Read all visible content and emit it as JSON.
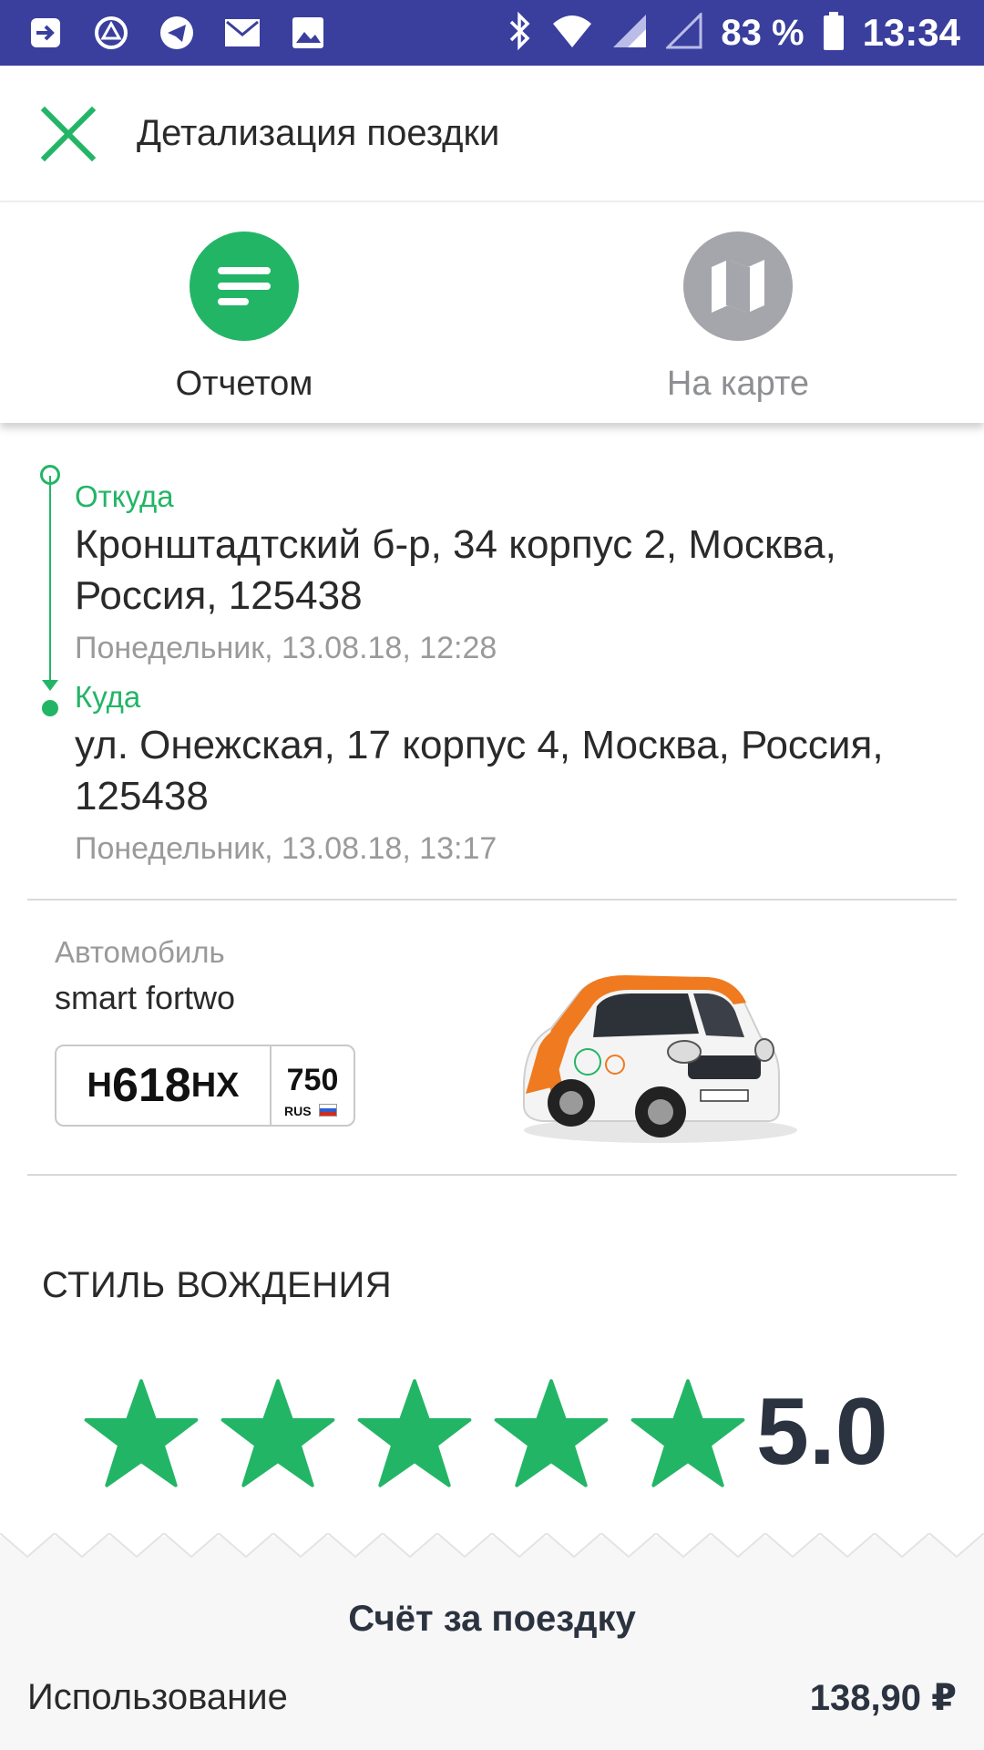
{
  "status_bar": {
    "battery": "83 %",
    "time": "13:34",
    "icons": [
      "exit-icon",
      "vpn-icon",
      "telegram-icon",
      "mail-icon",
      "image-icon",
      "bluetooth-icon",
      "wifi-icon",
      "signal-icon",
      "signal-empty-icon",
      "battery-icon"
    ]
  },
  "app_bar": {
    "title": "Детализация поездки"
  },
  "tabs": [
    {
      "label": "Отчетом",
      "active": true
    },
    {
      "label": "На карте",
      "active": false
    }
  ],
  "route": {
    "from_label": "Откуда",
    "from_address": "Кронштадтский б-р, 34 корпус 2, Москва, Россия, 125438",
    "from_date": "Понедельник, 13.08.18, 12:28",
    "to_label": "Куда",
    "to_address": "ул. Онежская, 17 корпус 4, Москва, Россия, 125438",
    "to_date": "Понедельник, 13.08.18, 13:17"
  },
  "car": {
    "label": "Автомобиль",
    "model": "smart fortwo",
    "plate": {
      "prefix": "Н",
      "number": "618",
      "suffix": "НХ",
      "region": "750",
      "country": "RUS"
    }
  },
  "driving_style": {
    "title": "СТИЛЬ ВОЖДЕНИЯ",
    "rating": 5,
    "max_rating": 5,
    "score": "5.0"
  },
  "bill": {
    "title": "Счёт за поездку",
    "items": [
      {
        "label": "Использование",
        "amount": "138,90 ₽"
      }
    ]
  },
  "colors": {
    "accent": "#23b566",
    "status_bar": "#3a3f9e",
    "inactive": "#a4a6ab",
    "score_text": "#2c3340"
  }
}
